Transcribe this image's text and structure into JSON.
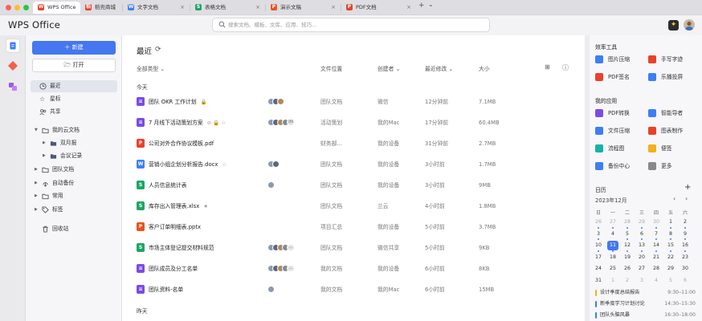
{
  "tabs": [
    {
      "label": "WPS Office",
      "icon": "wps-logo-icon",
      "color": "#e8412c"
    },
    {
      "label": "稻壳商城",
      "icon": "docer-icon",
      "color": "#e8412c"
    },
    {
      "label": "文字文档",
      "icon": "writer-icon",
      "color": "#3d7ef7"
    },
    {
      "label": "表格文档",
      "icon": "sheet-icon",
      "color": "#1ea565"
    },
    {
      "label": "演示文稿",
      "icon": "slides-icon",
      "color": "#e8541c"
    },
    {
      "label": "PDF文档",
      "icon": "pdf-icon",
      "color": "#e8412c"
    }
  ],
  "tab_add": "+",
  "tab_more": "⌄",
  "header": {
    "logo": "WPS Office",
    "search_placeholder": "搜索文档、模板、文库、应用、技巧..."
  },
  "nav": {
    "new_label": "新建",
    "open_label": "打开",
    "items": [
      {
        "label": "最近",
        "icon": "clock-icon",
        "active": true
      },
      {
        "label": "星标",
        "icon": "star-icon"
      },
      {
        "label": "共享",
        "icon": "share-icon"
      },
      {
        "label": "我的云文档",
        "icon": "cloud-folder-icon"
      },
      {
        "label": "双月报",
        "icon": "folder-icon"
      },
      {
        "label": "会议记录",
        "icon": "folder-icon"
      },
      {
        "label": "团队文档",
        "icon": "team-folder-icon"
      },
      {
        "label": "自动备份",
        "icon": "backup-icon"
      },
      {
        "label": "常用",
        "icon": "common-icon"
      },
      {
        "label": "标签",
        "icon": "tag-icon"
      },
      {
        "label": "回收站",
        "icon": "trash-icon"
      }
    ]
  },
  "main": {
    "title": "最近",
    "columns": {
      "type": "全部类型",
      "location": "文件位置",
      "creator": "创建者",
      "modified": "最近修改",
      "size": "大小"
    },
    "group_today": "今天",
    "group_yesterday": "昨天",
    "files": [
      {
        "name": "团队 OKR 工作计划",
        "type": "doc",
        "extra": "🔒",
        "location": "团队文档",
        "creator": "微信",
        "modified": "12分钟前",
        "size": "7.1MB",
        "avatars": 3,
        "more": ""
      },
      {
        "name": "7 月线下活动策划方案",
        "type": "doc",
        "extra": "⊘ 🔒 ☆",
        "location": "活动策划",
        "creator": "我的Mac",
        "modified": "17分钟前",
        "size": "60.4MB",
        "avatars": 4,
        "more": "99"
      },
      {
        "name": "公司对外合作协议模板.pdf",
        "type": "pdf",
        "extra": "",
        "location": "财务部...",
        "creator": "我的设备",
        "modified": "31分钟前",
        "size": "2.7MB",
        "avatars": 0,
        "more": ""
      },
      {
        "name": "营销小组企划分析报告.docx",
        "type": "word",
        "extra": "☆",
        "location": "团队文档",
        "creator": "我的设备",
        "modified": "3小时前",
        "size": "1.7MB",
        "avatars": 2,
        "more": ""
      },
      {
        "name": "人员信息统计表",
        "type": "sheet",
        "extra": "",
        "location": "团队文档",
        "creator": "我的设备",
        "modified": "3小时前",
        "size": "9MB",
        "avatars": 1,
        "more": ""
      },
      {
        "name": "库存出入管理表.xlsx",
        "type": "sheet",
        "extra": "★",
        "location": "团队文档",
        "creator": "兰云",
        "modified": "4小时前",
        "size": "1.8MB",
        "avatars": 0,
        "more": ""
      },
      {
        "name": "客户订单明细表.pptx",
        "type": "ppt",
        "extra": "",
        "location": "项目汇总",
        "creator": "我的设备",
        "modified": "5小时前",
        "size": "3.7MB",
        "avatars": 0,
        "more": ""
      },
      {
        "name": "市场主体登记提交材料规范",
        "type": "sheet",
        "extra": "",
        "location": "团队文档",
        "creator": "微信共享",
        "modified": "5小时前",
        "size": "9KB",
        "avatars": 4,
        "more": "…"
      },
      {
        "name": "团队成员及分工名单",
        "type": "doc",
        "extra": "",
        "location": "我的文档",
        "creator": "我的设备",
        "modified": "6小时前",
        "size": "8KB",
        "avatars": 4,
        "more": "…"
      },
      {
        "name": "团队资料-名单",
        "type": "doc",
        "extra": "",
        "location": "我的文档",
        "creator": "我的Mac",
        "modified": "6小时前",
        "size": "15MB",
        "avatars": 1,
        "more": ""
      }
    ]
  },
  "right": {
    "efficiency_title": "效率工具",
    "efficiency": [
      {
        "label": "图片压缩",
        "icon": "image-compress-icon",
        "color": "#3d7ef7"
      },
      {
        "label": "手写字迹",
        "icon": "handwriting-icon",
        "color": "#e8412c"
      },
      {
        "label": "PDF签名",
        "icon": "pdf-sign-icon",
        "color": "#e8412c"
      },
      {
        "label": "乐播投屏",
        "icon": "cast-icon",
        "color": "#3d7ef7"
      }
    ],
    "apps_title": "我的应用",
    "apps": [
      {
        "label": "PDF转换",
        "icon": "pdf-convert-icon",
        "color": "#7a4be8"
      },
      {
        "label": "智能导者",
        "icon": "smart-icon",
        "color": "#3d7ef7"
      },
      {
        "label": "文件压缩",
        "icon": "file-compress-icon",
        "color": "#3d7ef7"
      },
      {
        "label": "图表制作",
        "icon": "chart-make-icon",
        "color": "#e8412c"
      },
      {
        "label": "流程图",
        "icon": "flowchart-icon",
        "color": "#14b3a6"
      },
      {
        "label": "便签",
        "icon": "note-icon",
        "color": "#f2b01e"
      },
      {
        "label": "备份中心",
        "icon": "backup-center-icon",
        "color": "#3d7ef7"
      },
      {
        "label": "更多",
        "icon": "more-apps-icon",
        "color": "#888888"
      }
    ],
    "calendar_title": "日历",
    "calendar_month": "2023年12月",
    "weekdays": [
      "日",
      "一",
      "二",
      "三",
      "四",
      "五",
      "六"
    ],
    "days": [
      [
        "26",
        "27",
        "28",
        "29",
        "30",
        "1",
        "2"
      ],
      [
        "3",
        "4",
        "5",
        "6",
        "7",
        "8",
        "9"
      ],
      [
        "10",
        "11",
        "12",
        "13",
        "14",
        "15",
        "16"
      ],
      [
        "17",
        "18",
        "19",
        "20",
        "21",
        "22",
        "23"
      ],
      [
        "24",
        "25",
        "26",
        "27",
        "28",
        "29",
        "30"
      ],
      [
        "31",
        "1",
        "2",
        "3",
        "4",
        "5",
        "6"
      ]
    ],
    "selected_day": "11",
    "events": [
      {
        "title": "设计季度总结报告",
        "time": "9:30–11:00",
        "color": "#f2b01e"
      },
      {
        "title": "新季度学习计划讨论",
        "time": "14:30–15:30",
        "color": "#3d7ef7"
      },
      {
        "title": "团队头脑风暴",
        "time": "16:30–18:00",
        "color": "#3d7ef7"
      }
    ]
  }
}
